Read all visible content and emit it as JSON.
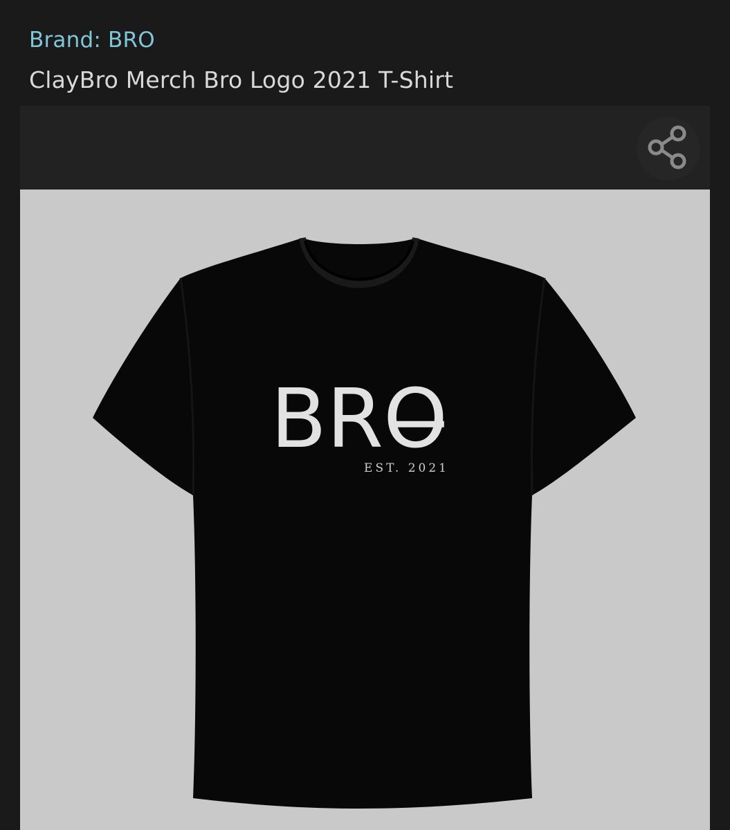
{
  "header": {
    "brand_link": "Brand: BRO",
    "product_title": "ClayBro Merch Bro Logo 2021 T-Shirt"
  },
  "gallery": {
    "share_icon": "share-icon",
    "product_image": {
      "shirt_color": "#080808",
      "background_color": "#c9c9c9",
      "print_logo": "BRO",
      "print_subtext": "EST. 2021"
    }
  },
  "colors": {
    "page_bg": "#1a1a1a",
    "link": "#7fc6d8",
    "title_text": "#d9d9d9",
    "topbar": "#222222",
    "icon": "#8a8a8a"
  }
}
